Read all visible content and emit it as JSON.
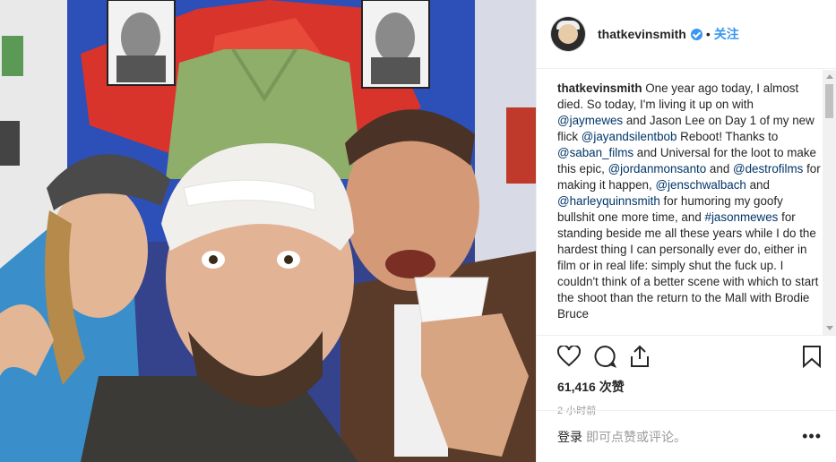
{
  "post": {
    "username": "thatkevinsmith",
    "follow_label": "关注",
    "caption_username": "thatkevinsmith",
    "caption_segments": [
      {
        "text": "One year ago today, I almost died. So today, I'm living it up on with ",
        "link": false
      },
      {
        "text": "@jaymewes",
        "link": true
      },
      {
        "text": " and Jason Lee on Day 1 of my new flick ",
        "link": false
      },
      {
        "text": "@jayandsilentbob",
        "link": true
      },
      {
        "text": " Reboot! Thanks to ",
        "link": false
      },
      {
        "text": "@saban_films",
        "link": true
      },
      {
        "text": " and Universal for the loot to make this epic, ",
        "link": false
      },
      {
        "text": "@jordanmonsanto",
        "link": true
      },
      {
        "text": " and ",
        "link": false
      },
      {
        "text": "@destrofilms",
        "link": true
      },
      {
        "text": " for making it happen, ",
        "link": false
      },
      {
        "text": "@jenschwalbach",
        "link": true
      },
      {
        "text": " and ",
        "link": false
      },
      {
        "text": "@harleyquinnsmith",
        "link": true
      },
      {
        "text": " for humoring my goofy bullshit one more time, and ",
        "link": false
      },
      {
        "text": "#jasonmewes",
        "link": true
      },
      {
        "text": " for standing beside me all these years while I do the hardest thing I can personally ever do, either in film or in real life: simply shut the fuck up. I couldn't think of a better scene with which to start the shoot than the return to the Mall with Brodie Bruce",
        "link": false
      }
    ],
    "likes": "61,416 次赞",
    "time": "2 小时前",
    "login_label": "登录",
    "comment_prompt": "即可点赞或评论。",
    "more_label": "•••"
  },
  "icons": {
    "like": "heart-icon",
    "comment": "comment-icon",
    "share": "share-icon",
    "save": "bookmark-icon",
    "verified": "verified-badge-icon"
  },
  "colors": {
    "link": "#003569",
    "accent": "#3897f0",
    "muted": "#999999"
  }
}
